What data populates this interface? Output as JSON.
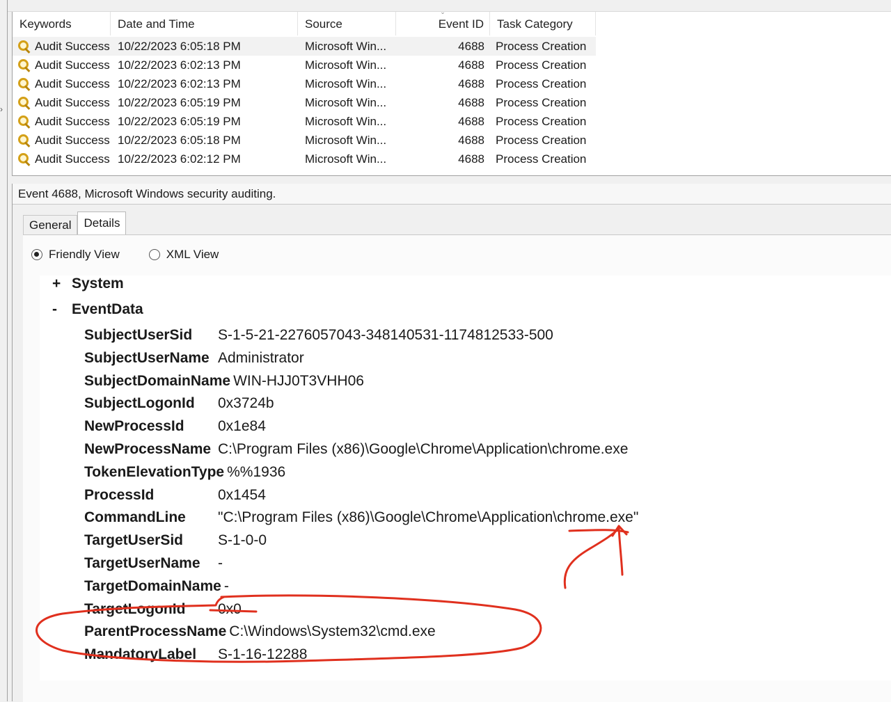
{
  "grid": {
    "columns": {
      "keywords": "Keywords",
      "date_time": "Date and Time",
      "source": "Source",
      "event_id": "Event ID",
      "task_category": "Task Category"
    },
    "rows": [
      {
        "keywords": "Audit Success",
        "date_time": "10/22/2023 6:05:18 PM",
        "source": "Microsoft Win...",
        "event_id": "4688",
        "task_category": "Process Creation"
      },
      {
        "keywords": "Audit Success",
        "date_time": "10/22/2023 6:02:13 PM",
        "source": "Microsoft Win...",
        "event_id": "4688",
        "task_category": "Process Creation"
      },
      {
        "keywords": "Audit Success",
        "date_time": "10/22/2023 6:02:13 PM",
        "source": "Microsoft Win...",
        "event_id": "4688",
        "task_category": "Process Creation"
      },
      {
        "keywords": "Audit Success",
        "date_time": "10/22/2023 6:05:19 PM",
        "source": "Microsoft Win...",
        "event_id": "4688",
        "task_category": "Process Creation"
      },
      {
        "keywords": "Audit Success",
        "date_time": "10/22/2023 6:05:19 PM",
        "source": "Microsoft Win...",
        "event_id": "4688",
        "task_category": "Process Creation"
      },
      {
        "keywords": "Audit Success",
        "date_time": "10/22/2023 6:05:18 PM",
        "source": "Microsoft Win...",
        "event_id": "4688",
        "task_category": "Process Creation"
      },
      {
        "keywords": "Audit Success",
        "date_time": "10/22/2023 6:02:12 PM",
        "source": "Microsoft Win...",
        "event_id": "4688",
        "task_category": "Process Creation"
      }
    ],
    "row_icon": "key-icon"
  },
  "details": {
    "title": "Event 4688, Microsoft Windows security auditing.",
    "tabs": {
      "general": "General",
      "details": "Details"
    },
    "view_options": {
      "friendly": "Friendly View",
      "xml": "XML View"
    },
    "system_toggle": "+",
    "system_label": "System",
    "eventdata_toggle": "-",
    "eventdata_label": "EventData",
    "fields": [
      {
        "name": "SubjectUserSid",
        "value": "S-1-5-21-2276057043-348140531-1174812533-500"
      },
      {
        "name": "SubjectUserName",
        "value": "Administrator"
      },
      {
        "name": "SubjectDomainName",
        "value": "WIN-HJJ0T3VHH06"
      },
      {
        "name": "SubjectLogonId",
        "value": "0x3724b"
      },
      {
        "name": "NewProcessId",
        "value": "0x1e84"
      },
      {
        "name": "NewProcessName",
        "value": "C:\\Program Files (x86)\\Google\\Chrome\\Application\\chrome.exe"
      },
      {
        "name": "TokenElevationType",
        "value": "%%1936"
      },
      {
        "name": "ProcessId",
        "value": "0x1454"
      },
      {
        "name": "CommandLine",
        "value": "\"C:\\Program Files (x86)\\Google\\Chrome\\Application\\chrome.exe\""
      },
      {
        "name": "TargetUserSid",
        "value": "S-1-0-0"
      },
      {
        "name": "TargetUserName",
        "value": "-"
      },
      {
        "name": "TargetDomainName",
        "value": "-"
      },
      {
        "name": "TargetLogonId",
        "value": "0x0"
      },
      {
        "name": "ParentProcessName",
        "value": "C:\\Windows\\System32\\cmd.exe"
      },
      {
        "name": "MandatoryLabel",
        "value": "S-1-16-12288"
      }
    ]
  },
  "colors": {
    "annotation": "#e0301e",
    "selected_row": "#f2f2f2"
  }
}
